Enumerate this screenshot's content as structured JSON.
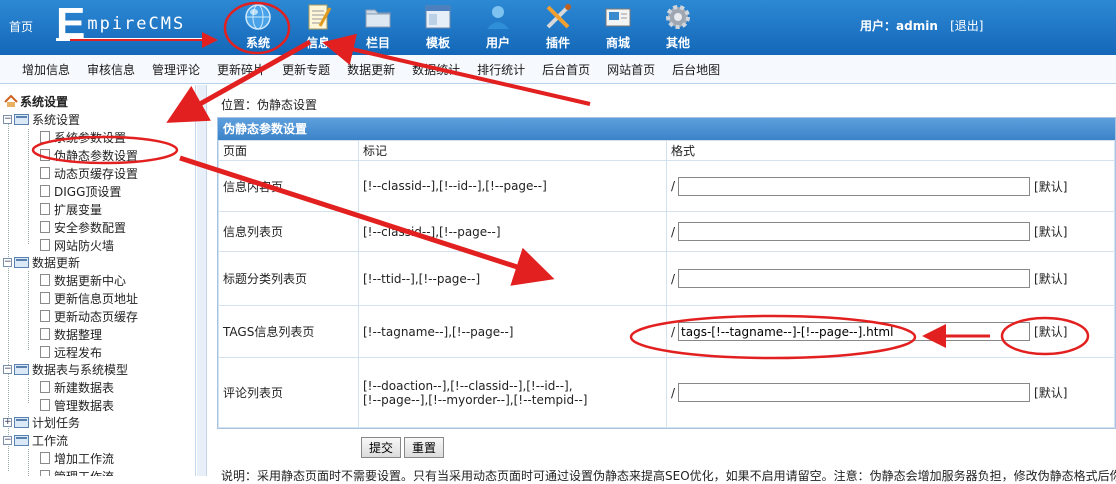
{
  "header": {
    "home": "首页",
    "logo_initial": "E",
    "logo_rest": "mpireCMS",
    "nav": [
      {
        "label": "系统",
        "icon": "globe-icon"
      },
      {
        "label": "信息",
        "icon": "notepad-icon"
      },
      {
        "label": "栏目",
        "icon": "folder-icon"
      },
      {
        "label": "模板",
        "icon": "window-icon"
      },
      {
        "label": "用户",
        "icon": "user-icon"
      },
      {
        "label": "插件",
        "icon": "tools-icon"
      },
      {
        "label": "商城",
        "icon": "shop-icon"
      },
      {
        "label": "其他",
        "icon": "gear-icon"
      }
    ],
    "user_prefix": "用户：",
    "username": "admin",
    "logout": "[退出]"
  },
  "submenu": [
    "增加信息",
    "审核信息",
    "管理评论",
    "更新碎片",
    "更新专题",
    "数据更新",
    "数据统计",
    "排行统计",
    "后台首页",
    "网站首页",
    "后台地图"
  ],
  "sidebar": {
    "title": "系统设置",
    "groups": [
      {
        "label": "系统设置",
        "items": [
          "系统参数设置",
          "伪静态参数设置",
          "动态页缓存设置",
          "DIGG顶设置",
          "扩展变量",
          "安全参数配置",
          "网站防火墙"
        ]
      },
      {
        "label": "数据更新",
        "items": [
          "数据更新中心",
          "更新信息页地址",
          "更新动态页缓存",
          "数据整理",
          "远程发布"
        ]
      },
      {
        "label": "数据表与系统模型",
        "items": [
          "新建数据表",
          "管理数据表"
        ]
      },
      {
        "label": "计划任务",
        "items": []
      },
      {
        "label": "工作流",
        "items": [
          "增加工作流",
          "管理工作流"
        ]
      }
    ]
  },
  "main": {
    "location": "位置：伪静态设置",
    "panel_title": "伪静态参数设置",
    "columns": [
      "页面",
      "标记",
      "格式"
    ],
    "rows": [
      {
        "page": "信息内容页",
        "tags": "[!--classid--],[!--id--],[!--page--]",
        "value": "",
        "default": "[默认]"
      },
      {
        "page": "信息列表页",
        "tags": "[!--classid--],[!--page--]",
        "value": "",
        "default": "[默认]"
      },
      {
        "page": "标题分类列表页",
        "tags": "[!--ttid--],[!--page--]",
        "value": "",
        "default": "[默认]"
      },
      {
        "page": "TAGS信息列表页",
        "tags": "[!--tagname--],[!--page--]",
        "value": "tags-[!--tagname--]-[!--page--].html",
        "default": "[默认]"
      },
      {
        "page": "评论列表页",
        "tags": "[!--doaction--],[!--classid--],[!--id--],",
        "tags2": "[!--page--],[!--myorder--],[!--tempid--]",
        "value": "",
        "default": "[默认]"
      }
    ],
    "slash": "/",
    "submit": "提交",
    "reset": "重置",
    "note": "说明：采用静态页面时不需要设置。只有当采用动态页面时可通过设置伪静态来提高SEO优化，如果不启用请留空。注意：伪静态会增加服务器负担，修改伪静态格式后你需要修改服务器的Rewrite规则设置。"
  }
}
